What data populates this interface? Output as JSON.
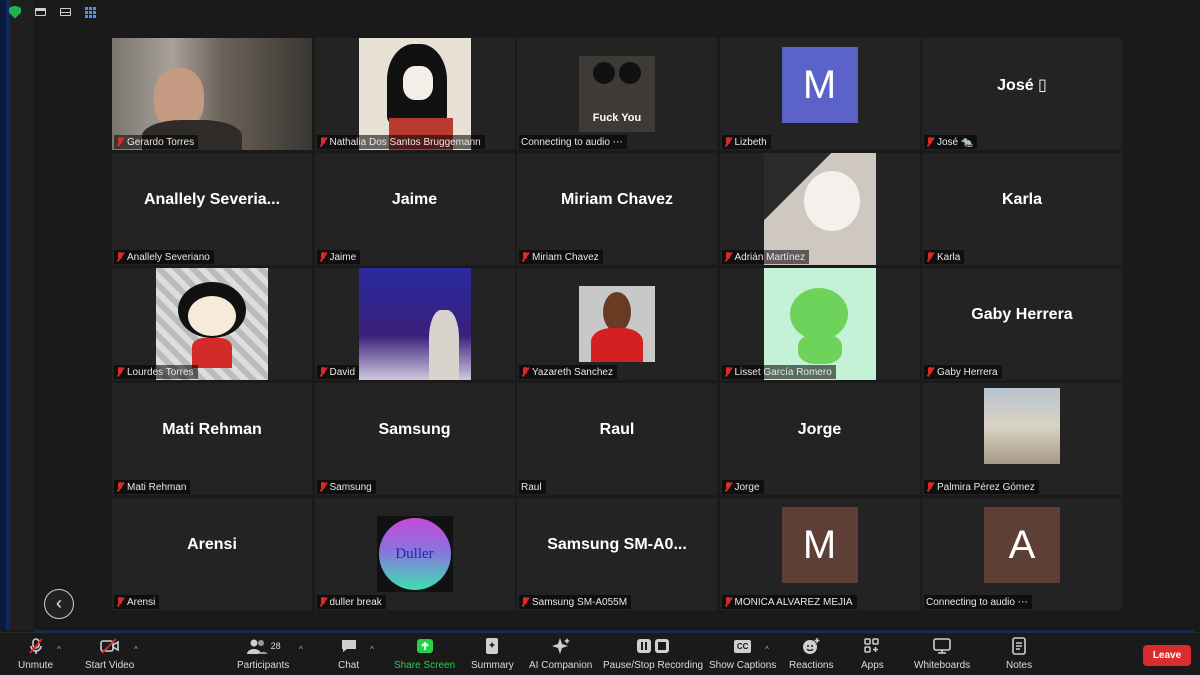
{
  "gallery": {
    "tiles": [
      {
        "label": "Gerardo Torres",
        "type": "photo"
      },
      {
        "label": "Nathalia Dos Santos Bruggemann",
        "type": "photo"
      },
      {
        "label": "Connecting to audio ⋯",
        "type": "photo",
        "image_text": "Fuck You"
      },
      {
        "label": "Lizbeth",
        "type": "avatar",
        "initial": "M",
        "color": "#5b63c8"
      },
      {
        "label": "José 🐀",
        "type": "name",
        "big": "José ▯"
      },
      {
        "label": "Anallely Severiano",
        "type": "name",
        "big": "Anallely  Severia..."
      },
      {
        "label": "Jaime",
        "type": "name",
        "big": "Jaime"
      },
      {
        "label": "Miriam Chavez",
        "type": "name",
        "big": "Miriam Chavez"
      },
      {
        "label": "Adrián Martínez",
        "type": "photo"
      },
      {
        "label": "Karla",
        "type": "name",
        "big": "Karla"
      },
      {
        "label": "Lourdes Torres",
        "type": "photo"
      },
      {
        "label": "David",
        "type": "photo"
      },
      {
        "label": "Yazareth Sanchez",
        "type": "photo"
      },
      {
        "label": "Lisset García Romero",
        "type": "photo"
      },
      {
        "label": "Gaby Herrera",
        "type": "name",
        "big": "Gaby Herrera"
      },
      {
        "label": "Mati Rehman",
        "type": "name",
        "big": "Mati Rehman"
      },
      {
        "label": "Samsung",
        "type": "name",
        "big": "Samsung"
      },
      {
        "label": "Raul",
        "type": "name",
        "big": "Raul"
      },
      {
        "label": "Jorge",
        "type": "name",
        "big": "Jorge"
      },
      {
        "label": "Palmira Pérez Gómez",
        "type": "photo"
      },
      {
        "label": "Arensi",
        "type": "name",
        "big": "Arensi"
      },
      {
        "label": "duller break",
        "type": "photo",
        "image_text": "Duller"
      },
      {
        "label": "Samsung SM-A055M",
        "type": "name",
        "big": "Samsung  SM-A0..."
      },
      {
        "label": "MONICA ALVAREZ MEJIA",
        "type": "avatar",
        "initial": "M",
        "color": "#5e3f35"
      },
      {
        "label": "Connecting to audio ⋯",
        "type": "avatar",
        "initial": "A",
        "color": "#5e3f35"
      }
    ]
  },
  "toolbar": {
    "unmute": "Unmute",
    "start_video": "Start Video",
    "participants": "Participants",
    "participants_count": "28",
    "chat": "Chat",
    "share_screen": "Share Screen",
    "summary": "Summary",
    "ai_companion": "AI Companion",
    "pause_recording": "Pause/Stop Recording",
    "show_captions": "Show Captions",
    "captions_badge": "CC",
    "reactions": "Reactions",
    "apps": "Apps",
    "whiteboards": "Whiteboards",
    "notes": "Notes",
    "leave": "Leave"
  },
  "colors": {
    "share_green": "#23d14b",
    "leave_red": "#d92c2c",
    "muted_red": "#e02828"
  }
}
